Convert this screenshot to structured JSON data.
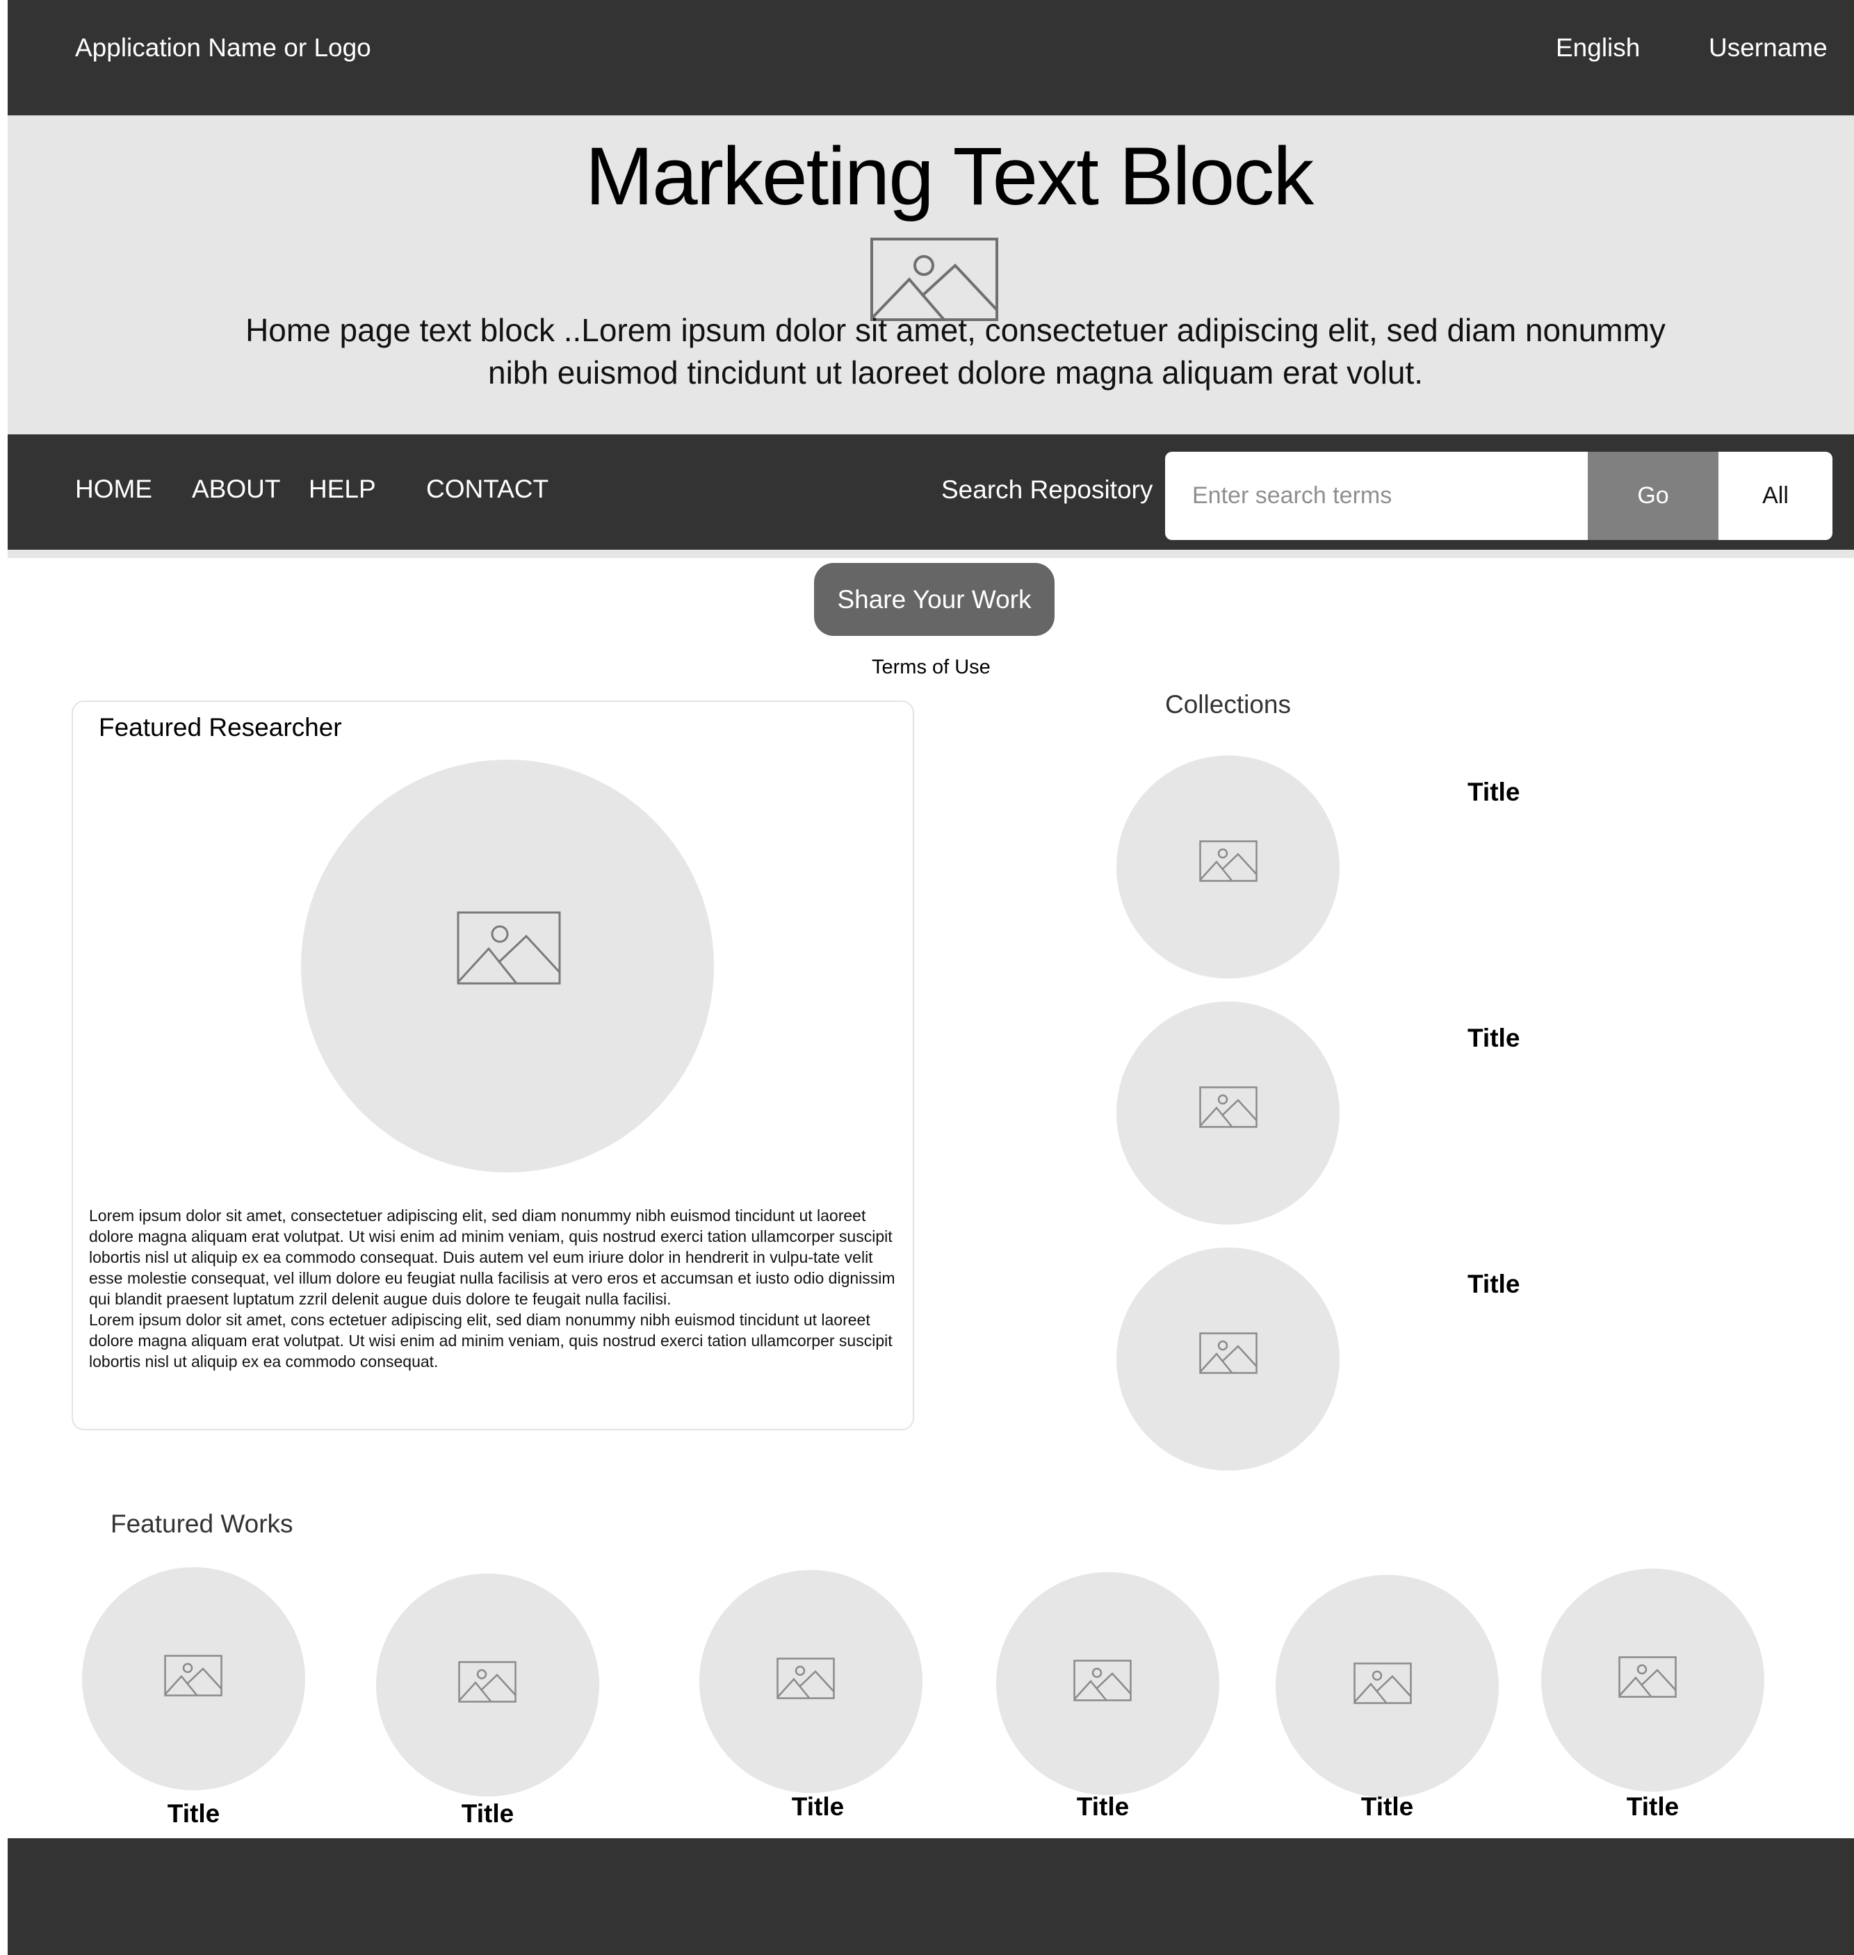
{
  "header": {
    "app_name": "Application Name or Logo",
    "language": "English",
    "username": "Username"
  },
  "hero": {
    "title": "Marketing Text Block",
    "image_icon": "image-placeholder-icon",
    "text": "Home page text block ..Lorem ipsum dolor sit amet, consectetuer adipiscing elit, sed diam nonummy nibh euismod tincidunt ut laoreet dolore magna aliquam erat volut."
  },
  "nav": {
    "items": [
      {
        "label": "HOME"
      },
      {
        "label": "ABOUT"
      },
      {
        "label": "HELP"
      },
      {
        "label": "CONTACT"
      }
    ],
    "search": {
      "label": "Search Repository",
      "placeholder": "Enter search terms",
      "value": "",
      "go_label": "Go",
      "scope_label": "All"
    }
  },
  "share": {
    "button_label": "Share Your Work",
    "terms_label": "Terms of Use"
  },
  "researcher": {
    "heading": "Featured Researcher",
    "image_icon": "image-placeholder-icon",
    "bio_paragraph_1": "Lorem ipsum dolor sit amet, consectetuer adipiscing elit, sed diam nonummy nibh euismod tincidunt ut laoreet dolore magna aliquam erat volutpat. Ut wisi enim ad minim veniam, quis nostrud exerci tation ullamcorper suscipit lobortis nisl ut aliquip ex ea commodo consequat. Duis autem vel eum iriure dolor in hendrerit in vulpu-tate velit esse molestie consequat, vel illum dolore eu feugiat nulla facilisis at vero eros et accumsan et iusto odio dignissim qui blandit praesent luptatum zzril delenit augue duis dolore te feugait nulla facilisi.",
    "bio_paragraph_2": "Lorem ipsum dolor sit amet, cons ectetuer adipiscing elit, sed diam nonummy nibh euismod tincidunt ut laoreet dolore magna aliquam erat volutpat. Ut wisi enim ad minim veniam, quis nostrud exerci tation ullamcorper suscipit lobortis nisl ut aliquip ex ea commodo consequat."
  },
  "collections": {
    "heading": "Collections",
    "items": [
      {
        "title": "Title"
      },
      {
        "title": "Title"
      },
      {
        "title": "Title"
      }
    ]
  },
  "works": {
    "heading": "Featured Works",
    "items": [
      {
        "title": "Title"
      },
      {
        "title": "Title"
      },
      {
        "title": "Title"
      },
      {
        "title": "Title"
      },
      {
        "title": "Title"
      },
      {
        "title": "Title"
      }
    ]
  },
  "colors": {
    "dark_bar": "#333333",
    "light_panel": "#e6e6e6",
    "button_gray": "#666666",
    "go_gray": "#808080"
  }
}
